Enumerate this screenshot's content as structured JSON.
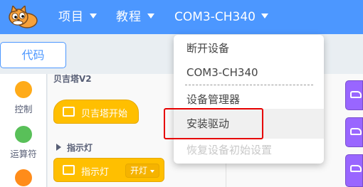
{
  "menubar": {
    "project_label": "项目",
    "tutorial_label": "教程",
    "device_label": "COM3-CH340",
    "bar_color": "#4c97ff"
  },
  "tabs": {
    "code_label": "代码"
  },
  "categories": [
    {
      "label": "控制",
      "color": "#ffab19"
    },
    {
      "label": "运算符",
      "color": "#59c059"
    },
    {
      "label": "",
      "color": "#ff8c1a"
    }
  ],
  "palette": {
    "title": "贝吉塔V2",
    "hat_block": {
      "label": "贝吉塔开始",
      "icon": "board-icon"
    },
    "section_title": "指示灯",
    "command_block": {
      "label": "指示灯",
      "icon": "board-icon",
      "dropdown_value": "开灯"
    }
  },
  "scripts": {
    "block_icon": "car-icon",
    "block_color": "#9966ff"
  },
  "device_menu": {
    "items": [
      {
        "label": "断开设备",
        "enabled": true
      },
      {
        "label": "COM3-CH340",
        "enabled": true
      },
      {
        "label": "设备管理器",
        "enabled": true
      },
      {
        "label": "安装驱动",
        "enabled": true,
        "hovered": true
      },
      {
        "label": "恢复设备初始设置",
        "enabled": false
      }
    ],
    "annotation_color": "#e60000"
  }
}
